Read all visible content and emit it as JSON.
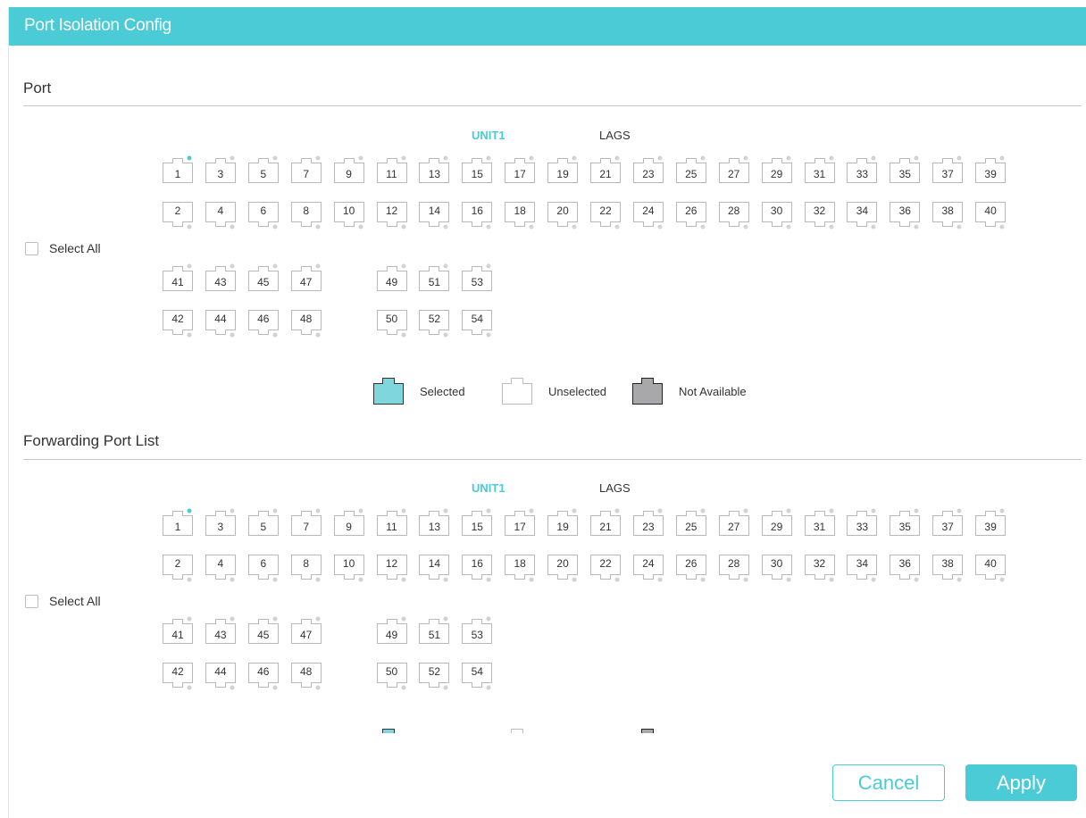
{
  "title": "Port Isolation Config",
  "colors": {
    "accent": "#4acbd6",
    "selected": "#7fd6dd",
    "not_available": "#a8a8ab"
  },
  "sections": [
    {
      "heading": "Port",
      "unit_label": "UNIT1",
      "lags_label": "LAGS",
      "select_all_label": "Select All",
      "ports_row1": [
        "1",
        "3",
        "5",
        "7",
        "9",
        "11",
        "13",
        "15",
        "17",
        "19",
        "21",
        "23",
        "25",
        "27",
        "29",
        "31",
        "33",
        "35",
        "37",
        "39"
      ],
      "ports_row2": [
        "2",
        "4",
        "6",
        "8",
        "10",
        "12",
        "14",
        "16",
        "18",
        "20",
        "22",
        "24",
        "26",
        "28",
        "30",
        "32",
        "34",
        "36",
        "38",
        "40"
      ],
      "ports_row3a": [
        "41",
        "43",
        "45",
        "47"
      ],
      "ports_row3b": [
        "49",
        "51",
        "53"
      ],
      "ports_row4a": [
        "42",
        "44",
        "46",
        "48"
      ],
      "ports_row4b": [
        "50",
        "52",
        "54"
      ]
    },
    {
      "heading": "Forwarding Port List",
      "unit_label": "UNIT1",
      "lags_label": "LAGS",
      "select_all_label": "Select All",
      "ports_row1": [
        "1",
        "3",
        "5",
        "7",
        "9",
        "11",
        "13",
        "15",
        "17",
        "19",
        "21",
        "23",
        "25",
        "27",
        "29",
        "31",
        "33",
        "35",
        "37",
        "39"
      ],
      "ports_row2": [
        "2",
        "4",
        "6",
        "8",
        "10",
        "12",
        "14",
        "16",
        "18",
        "20",
        "22",
        "24",
        "26",
        "28",
        "30",
        "32",
        "34",
        "36",
        "38",
        "40"
      ],
      "ports_row3a": [
        "41",
        "43",
        "45",
        "47"
      ],
      "ports_row3b": [
        "49",
        "51",
        "53"
      ],
      "ports_row4a": [
        "42",
        "44",
        "46",
        "48"
      ],
      "ports_row4b": [
        "50",
        "52",
        "54"
      ]
    }
  ],
  "legend": {
    "selected": "Selected",
    "unselected": "Unselected",
    "not_available": "Not Available"
  },
  "buttons": {
    "cancel": "Cancel",
    "apply": "Apply"
  }
}
